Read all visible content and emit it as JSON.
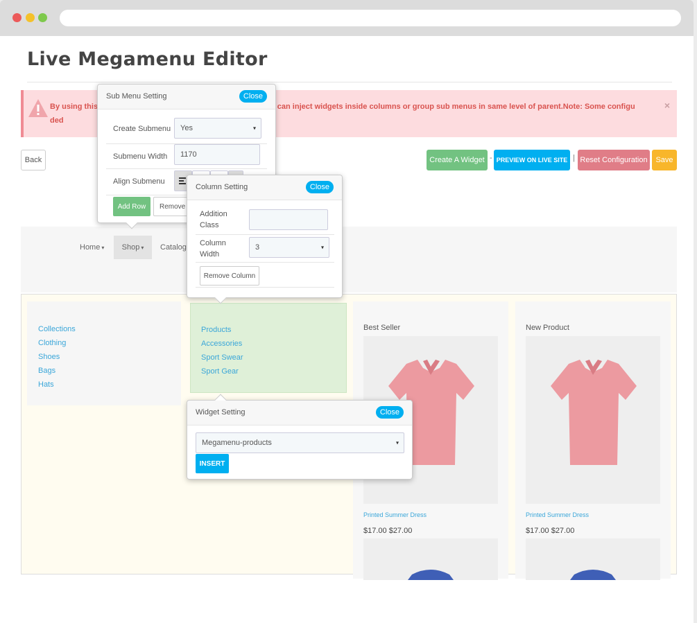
{
  "page": {
    "title": "Live Megamenu Editor"
  },
  "alert": {
    "text": "By using this t                                    and multiple columns. You can inject widgets inside columns or group sub menus in same level of parent.Note: Some configu                                                               ded",
    "close": "×"
  },
  "toolbar": {
    "back": "Back",
    "create_widget": "Create A Widget",
    "sep1": "-",
    "preview": "PREVIEW ON LIVE SITE",
    "sep2": "|",
    "reset": "Reset Configuration",
    "save": "Save"
  },
  "menu": {
    "items": [
      {
        "label": "Home",
        "caret": "▾"
      },
      {
        "label": "Shop",
        "caret": "▾"
      },
      {
        "label": "Catalog",
        "caret": "▾"
      }
    ]
  },
  "mega": {
    "col1_links": [
      "Collections",
      "Clothing",
      "Shoes",
      "Bags",
      "Hats"
    ],
    "col2_links": [
      "Products",
      "Accessories",
      "Sport Swear",
      "Sport Gear"
    ],
    "products": [
      {
        "heading": "Best Seller",
        "name": "Printed Summer Dress",
        "price": "$17.00 $27.00"
      },
      {
        "heading": "New Product",
        "name": "Printed Summer Dress",
        "price": "$17.00 $27.00"
      }
    ]
  },
  "submenu_popup": {
    "title": "Sub Menu Setting",
    "close": "Close",
    "create_label": "Create Submenu",
    "create_value": "Yes",
    "width_label": "Submenu Width",
    "width_value": "1170",
    "align_label": "Align Submenu",
    "add_row": "Add Row",
    "remove_row": "Remove R"
  },
  "column_popup": {
    "title": "Column Setting",
    "close": "Close",
    "class_label": "Addition Class",
    "width_label": "Column Width",
    "width_value": "3",
    "remove": "Remove Column"
  },
  "widget_popup": {
    "title": "Widget Setting",
    "close": "Close",
    "select_value": "Megamenu-products",
    "insert": "INSERT"
  },
  "colors": {
    "accent_blue": "#00aff0",
    "green": "#72c281",
    "reset_red": "#e07d87",
    "save_orange": "#f8b62b",
    "alert_bg": "#fddcdf",
    "link_blue": "#3aa6d9"
  },
  "icons": {
    "caret": "▾"
  }
}
